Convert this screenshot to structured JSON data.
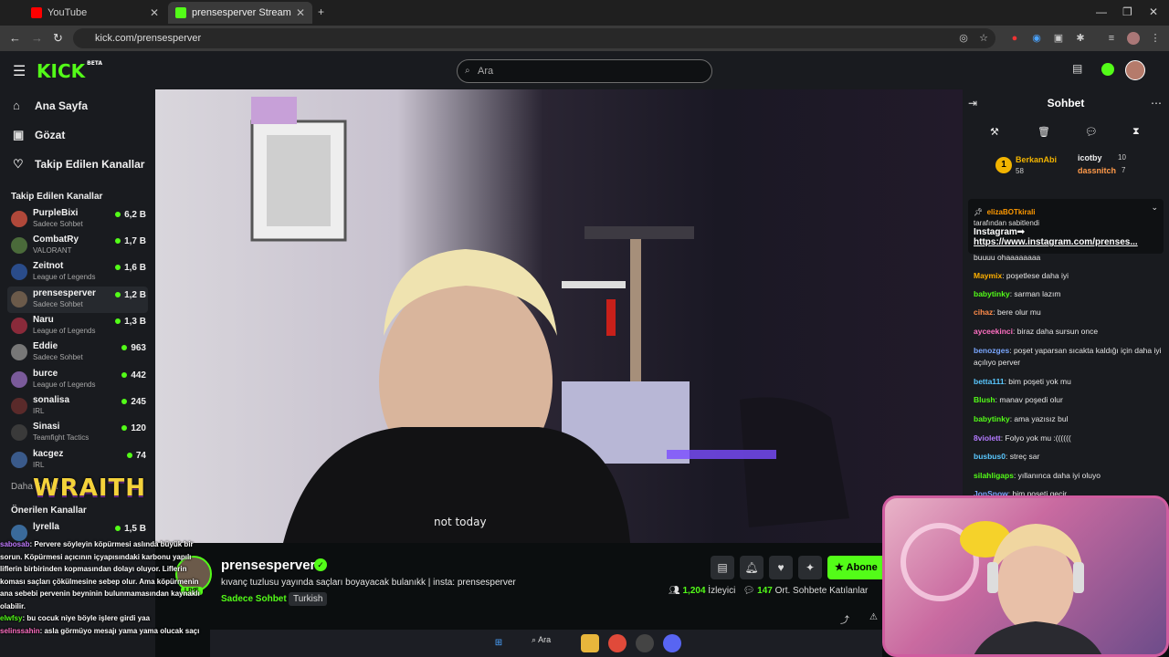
{
  "browser": {
    "tabs": [
      {
        "title": "YouTube",
        "active": false
      },
      {
        "title": "prensesperver Stream - Wa",
        "active": true
      }
    ],
    "url": "kick.com/prensesperver"
  },
  "header": {
    "logo": "KICK",
    "logo_badge": "BETA",
    "search_placeholder": "Ara"
  },
  "sidebar": {
    "nav": [
      {
        "label": "Ana Sayfa",
        "icon": "home-icon"
      },
      {
        "label": "Gözat",
        "icon": "browse-icon"
      },
      {
        "label": "Takip Edilen Kanallar",
        "icon": "heart-icon"
      }
    ],
    "followed_title": "Takip Edilen Kanallar",
    "channels": [
      {
        "name": "PurpleBixi",
        "category": "Sadece Sohbet",
        "viewers": "6,2 B",
        "color": "#b0483a"
      },
      {
        "name": "CombatRy",
        "category": "VALORANT",
        "viewers": "1,7 B",
        "color": "#4a6a3a"
      },
      {
        "name": "Zeitnot",
        "category": "League of Legends",
        "viewers": "1,6 B",
        "color": "#2a4c8a"
      },
      {
        "name": "prensesperver",
        "category": "Sadece Sohbet",
        "viewers": "1,2 B",
        "color": "#6b5a4a"
      },
      {
        "name": "Naru",
        "category": "League of Legends",
        "viewers": "1,3 B",
        "color": "#8a2a3a"
      },
      {
        "name": "Eddie",
        "category": "Sadece Sohbet",
        "viewers": "963",
        "color": "#777777"
      },
      {
        "name": "burce",
        "category": "League of Legends",
        "viewers": "442",
        "color": "#7a5a9a"
      },
      {
        "name": "sonalisa",
        "category": "IRL",
        "viewers": "245",
        "color": "#5a2a2a"
      },
      {
        "name": "Sinasi",
        "category": "Teamfight Tactics",
        "viewers": "120",
        "color": "#3a3a3a"
      },
      {
        "name": "kacgez",
        "category": "IRL",
        "viewers": "74",
        "color": "#3a5a8a"
      }
    ],
    "more_label": "Daha Fazla",
    "suggested_title": "Önerilen Kanallar",
    "suggested": [
      {
        "name": "lyrella",
        "viewers": "1,5 B"
      }
    ]
  },
  "stream": {
    "streamer": "prensesperver",
    "live_badge": "LIVE",
    "title": "kıvanç tuzlusu yayında saçları boyayacak bulanıkk | insta: prensesperver",
    "category": "Sadece Sohbet",
    "language": "Turkish",
    "subscribe_label": "Abone",
    "viewer_count": "1,204",
    "viewer_label": "İzleyici",
    "chatters_count": "147",
    "chatters_label": "Ort. Sohbete Katılanlar"
  },
  "chat": {
    "title": "Sohbet",
    "leaders": [
      {
        "rank": "1",
        "name": "BerkanAbi",
        "count": "58"
      },
      {
        "name": "icotby",
        "count": "10"
      },
      {
        "name": "dassnitch",
        "count": "7"
      }
    ],
    "pinned": {
      "user": "elizaBOTkirali",
      "by": "tarafından sabitlendi",
      "text": "Instagram➟",
      "link": "https://www.instagram.com/prenses..."
    },
    "messages": [
      {
        "user": "",
        "text": "buuuu ohaaaaaaaa",
        "color": "#e6e6e6"
      },
      {
        "user": "Maymix",
        "text": "poşetlese daha iyi",
        "color": "#ffb000"
      },
      {
        "user": "babytinky",
        "text": "sarman lazım",
        "color": "#53fc18"
      },
      {
        "user": "cihaz",
        "text": "bere olur mu",
        "color": "#ff8c4a"
      },
      {
        "user": "ayceekinci",
        "text": "biraz daha sursun once",
        "color": "#ff6fc2"
      },
      {
        "user": "benozges",
        "text": "poşet yaparsan sıcakta kaldığı için daha iyi açılıyo perver",
        "color": "#7aa7ff"
      },
      {
        "user": "betta111",
        "text": "bim poşeti yok mu",
        "color": "#5ac8ff"
      },
      {
        "user": "Blush",
        "text": "manav poşedi olur",
        "color": "#53fc18"
      },
      {
        "user": "babytinky",
        "text": "ama yazısız bul",
        "color": "#53fc18"
      },
      {
        "user": "8violett",
        "text": "Folyo yok mu :((((((",
        "color": "#b47aff"
      },
      {
        "user": "busbus0",
        "text": "streç sar",
        "color": "#5ac8ff"
      },
      {
        "user": "silahligaps",
        "text": "yıllanınca daha iyi oluyo",
        "color": "#53fc18"
      },
      {
        "user": "JonSnow",
        "text": "bim poşeti geçir",
        "color": "#7aa7ff"
      }
    ]
  },
  "overlay": {
    "brand": "WRAITH",
    "messages": [
      {
        "user": "sabosab",
        "text": "Pervere söyleyin köpürmesi aslında büyük bir sorun. Köpürmesi açıcının içyapısındaki karbonu yapılı liflerin birbirinden kopmasından dolayı oluyor. Liflerin koması saçları çökülmesine sebep olur. Ama köpürmenin ana sebebi pervenin beyninin bulunmamasından kaynaklı olabilir."
      },
      {
        "user": "elwfsy",
        "text": "bu cocuk niye böyle işlere girdi yaa"
      },
      {
        "user": "selinssahin",
        "text": "asla görmüyo mesajı yama yama olucak saçı"
      }
    ]
  },
  "taskbar": {
    "search_label": "Ara"
  }
}
